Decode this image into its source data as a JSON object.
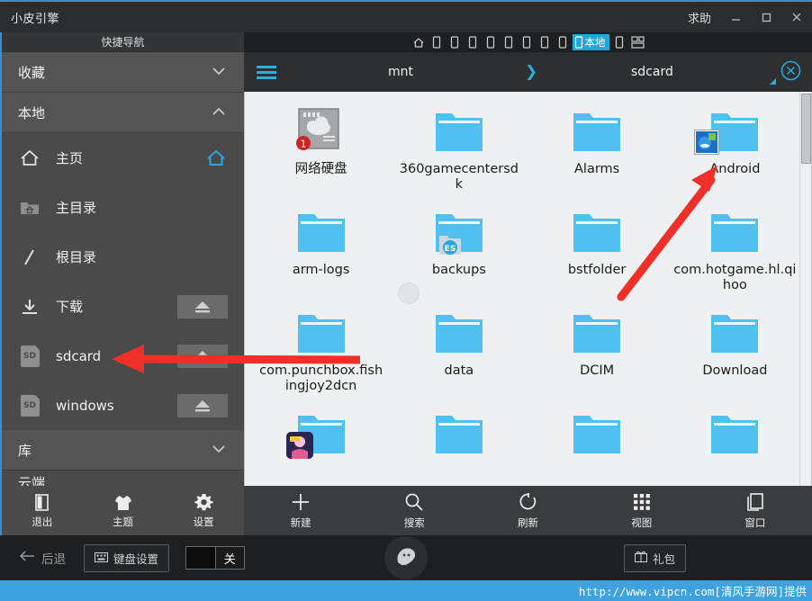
{
  "window": {
    "app_title": "小皮引擎",
    "help_label": "求助",
    "minimize_icon": "minimize-icon",
    "maximize_icon": "maximize-icon",
    "close_icon": "close-icon",
    "accent_color": "#3a8fd0"
  },
  "sidebar": {
    "header": "快捷导航",
    "sections": [
      {
        "label": "收藏",
        "chevron": "chevron-down-icon",
        "expanded": false
      },
      {
        "label": "本地",
        "chevron": "chevron-up-icon",
        "expanded": true
      }
    ],
    "items": [
      {
        "label": "主页",
        "icon": "home-icon",
        "trailing": "home-accent-icon"
      },
      {
        "label": "主目录",
        "icon": "folder-home-icon",
        "trailing": ""
      },
      {
        "label": "根目录",
        "icon": "slash-icon",
        "trailing": ""
      },
      {
        "label": "下载",
        "icon": "download-icon",
        "trailing": "eject-icon"
      },
      {
        "label": "sdcard",
        "icon": "sd-card-icon",
        "trailing": "eject-icon"
      },
      {
        "label": "windows",
        "icon": "sd-card-icon",
        "trailing": "eject-icon"
      }
    ],
    "library_section": {
      "label": "库",
      "chevron": "chevron-down-icon"
    },
    "partial_item": "云端"
  },
  "left_tools": [
    {
      "label": "退出",
      "icon": "exit-door-icon"
    },
    {
      "label": "主题",
      "icon": "tshirt-icon"
    },
    {
      "label": "设置",
      "icon": "gear-icon"
    }
  ],
  "tabstrip": {
    "home_tab_icon": "home-icon",
    "device_tabs": 8,
    "active_tab": {
      "label": "本地",
      "icon": "phone-icon",
      "color": "#1fa8d8"
    },
    "trailing_tab_icon": "phone-icon",
    "multiwindow_icon": "multi-window-icon"
  },
  "breadcrumb": {
    "menu_icon": "hamburger-menu-icon",
    "path": [
      "mnt",
      "sdcard"
    ],
    "separator": "❯",
    "close_icon": "close-circle-icon",
    "resize_icon": "resize-corner-icon"
  },
  "files": {
    "rows": [
      [
        {
          "name": "网络硬盘",
          "type": "network-drive",
          "badge": "1"
        },
        {
          "name": "360gamecentersdk",
          "type": "folder"
        },
        {
          "name": "Alarms",
          "type": "folder"
        },
        {
          "name": "Android",
          "type": "folder",
          "overlay": "app-icon"
        }
      ],
      [
        {
          "name": "arm-logs",
          "type": "folder"
        },
        {
          "name": "backups",
          "type": "folder",
          "overlay": "es-icon"
        },
        {
          "name": "bstfolder",
          "type": "folder"
        },
        {
          "name": "com.hotgame.hl.qihoo",
          "type": "folder"
        }
      ],
      [
        {
          "name": "com.punchbox.fishingjoy2dcn",
          "type": "folder"
        },
        {
          "name": "data",
          "type": "folder"
        },
        {
          "name": "DCIM",
          "type": "folder"
        },
        {
          "name": "Download",
          "type": "folder"
        }
      ],
      [
        {
          "name": "",
          "type": "folder",
          "overlay": "game-icon"
        },
        {
          "name": "",
          "type": "folder"
        },
        {
          "name": "",
          "type": "folder"
        },
        {
          "name": "",
          "type": "folder"
        }
      ]
    ]
  },
  "bottom_toolbar": [
    {
      "label": "新建",
      "icon": "plus-icon"
    },
    {
      "label": "搜索",
      "icon": "search-icon"
    },
    {
      "label": "刷新",
      "icon": "refresh-icon"
    },
    {
      "label": "视图",
      "icon": "grid-view-icon"
    },
    {
      "label": "窗口",
      "icon": "window-icon"
    }
  ],
  "navbar": {
    "back_label": "后退",
    "back_icon": "arrow-left-icon",
    "keyboard_label": "键盘设置",
    "keyboard_icon": "keyboard-icon",
    "toggle_state": "关",
    "home_icon": "ghost-home-icon",
    "gift_label": "礼包",
    "gift_icon": "gift-icon"
  },
  "statusbar": {
    "text": "http://www.vipcn.com[清风手游网]提供",
    "background": "#3fa2e0"
  }
}
